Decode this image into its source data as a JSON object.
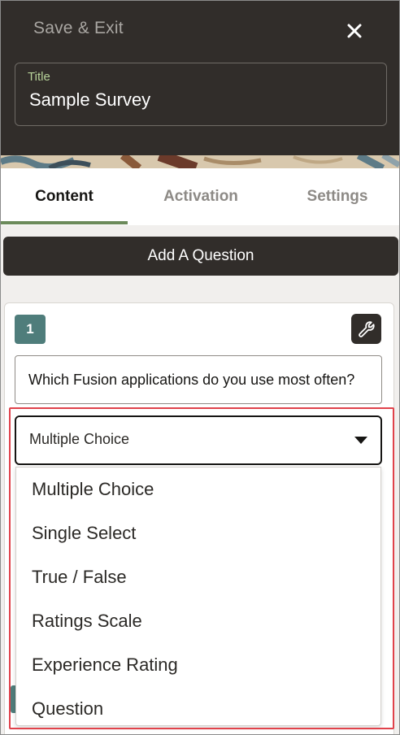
{
  "header": {
    "save_exit_label": "Save & Exit",
    "close_icon": "close-icon",
    "title_label": "Title",
    "title_value": "Sample Survey"
  },
  "tabs": [
    {
      "label": "Content",
      "active": true
    },
    {
      "label": "Activation",
      "active": false
    },
    {
      "label": "Settings",
      "active": false
    }
  ],
  "add_question_label": "Add A Question",
  "question": {
    "number": "1",
    "settings_icon": "wrench-icon",
    "text": "Which Fusion applications do you use most often?",
    "type_selected": "Multiple Choice",
    "type_options": [
      "Multiple Choice",
      "Single Select",
      "True / False",
      "Ratings Scale",
      "Experience Rating",
      "Question"
    ]
  },
  "colors": {
    "header_bg": "#312d2a",
    "accent_green": "#6b8a5a",
    "badge_teal": "#4f7d7b",
    "highlight_red": "#e0424b"
  }
}
